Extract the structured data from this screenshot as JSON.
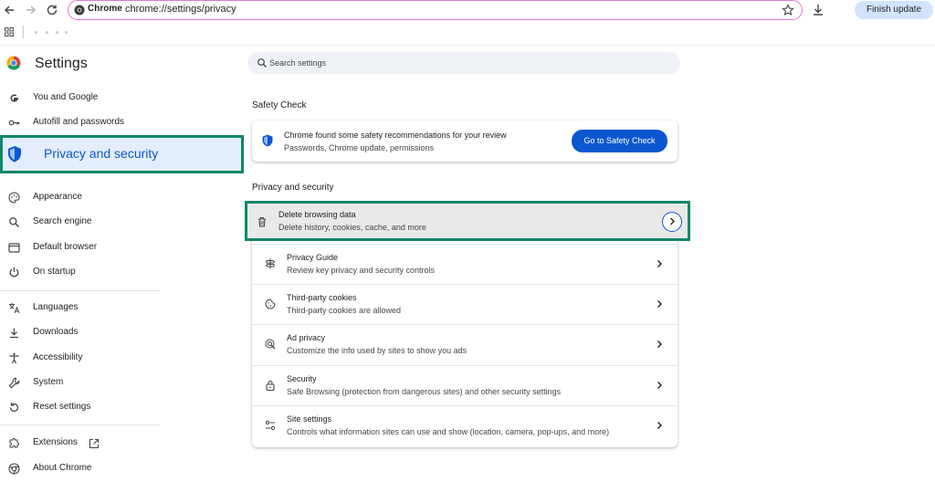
{
  "toolbar": {
    "omnibox_chip": "Chrome",
    "url": "chrome://settings/privacy",
    "finish_update_label": "Finish update"
  },
  "sidebar": {
    "title": "Settings",
    "items": [
      {
        "label": "You and Google",
        "icon": "google-g-icon"
      },
      {
        "label": "Autofill and passwords",
        "icon": "key-icon"
      },
      {
        "label": "Privacy and security",
        "icon": "shield-icon",
        "active": true
      },
      {
        "label": "Appearance",
        "icon": "palette-icon"
      },
      {
        "label": "Search engine",
        "icon": "search-icon"
      },
      {
        "label": "Default browser",
        "icon": "browser-window-icon"
      },
      {
        "label": "On startup",
        "icon": "power-icon"
      },
      {
        "label": "Languages",
        "icon": "translate-icon"
      },
      {
        "label": "Downloads",
        "icon": "download-icon"
      },
      {
        "label": "Accessibility",
        "icon": "accessibility-icon"
      },
      {
        "label": "System",
        "icon": "wrench-icon"
      },
      {
        "label": "Reset settings",
        "icon": "reset-icon"
      },
      {
        "label": "Extensions",
        "icon": "puzzle-icon"
      },
      {
        "label": "About Chrome",
        "icon": "chrome-logo-icon"
      }
    ]
  },
  "search": {
    "placeholder": "Search settings"
  },
  "safety_check": {
    "section_title": "Safety Check",
    "title": "Chrome found some safety recommendations for your review",
    "subtitle": "Passwords, Chrome update, permissions",
    "button_label": "Go to Safety Check"
  },
  "privacy": {
    "section_title": "Privacy and security",
    "rows": [
      {
        "title": "Delete browsing data",
        "subtitle": "Delete history, cookies, cache, and more",
        "icon": "trash-icon"
      },
      {
        "title": "Privacy Guide",
        "subtitle": "Review key privacy and security controls",
        "icon": "signpost-icon"
      },
      {
        "title": "Third-party cookies",
        "subtitle": "Third-party cookies are allowed",
        "icon": "cookie-icon"
      },
      {
        "title": "Ad privacy",
        "subtitle": "Customize the info used by sites to show you ads",
        "icon": "ad-privacy-icon"
      },
      {
        "title": "Security",
        "subtitle": "Safe Browsing (protection from dangerous sites) and other security settings",
        "icon": "lock-icon"
      },
      {
        "title": "Site settings",
        "subtitle": "Controls what information sites can use and show (location, camera, pop-ups, and more)",
        "icon": "tune-icon"
      }
    ]
  },
  "colors": {
    "accent": "#0b57d0",
    "highlight_border": "#0d8868",
    "active_nav_bg": "#e3edfd"
  }
}
